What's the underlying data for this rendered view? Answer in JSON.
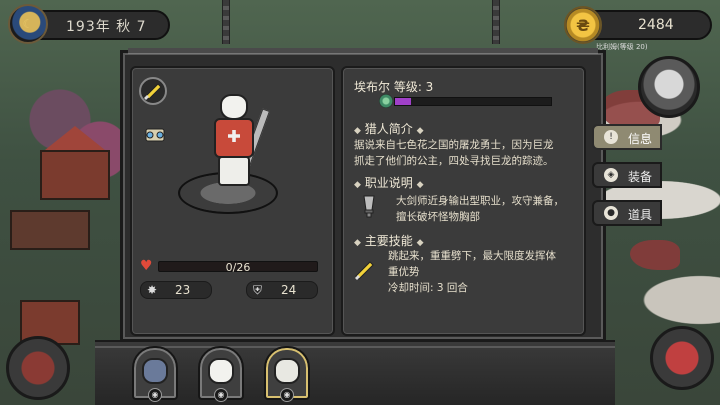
{
  "top_bar": {
    "date_text": "193年 秋 7",
    "gold_amount": "2484",
    "caption": "比利姆(等级 20)"
  },
  "hero": {
    "hp_text": "0/26",
    "hp_fraction": 0,
    "stat_attack": "23",
    "stat_defense": "24"
  },
  "info": {
    "name_level": "埃布尔   等级: 3",
    "exp_fraction": 0.1,
    "bio_title": "猎人简介",
    "bio_lines": [
      "据说来自七色花之国的屠龙勇士，因为巨龙",
      "抓走了他们的公主，四处寻找巨龙的踪迹。"
    ],
    "job_title": "职业说明",
    "job_lines": [
      "大剑师近身输出型职业，攻守兼备，",
      "擅长破坏怪物胸部"
    ],
    "skill_title": "主要技能",
    "skill_lines": [
      "跳起来，重重劈下，最大限度发挥体",
      "重优势"
    ],
    "cooldown": "冷却时间: 3 回合"
  },
  "tabs": [
    {
      "label": "信息",
      "icon": "info-icon",
      "active": true
    },
    {
      "label": "装备",
      "icon": "armor-icon",
      "active": false
    },
    {
      "label": "道具",
      "icon": "bag-icon",
      "active": false
    }
  ],
  "colors": {
    "hp": "#c0392b",
    "exp": "#a040c8",
    "active_tab": "#8f8a72"
  }
}
